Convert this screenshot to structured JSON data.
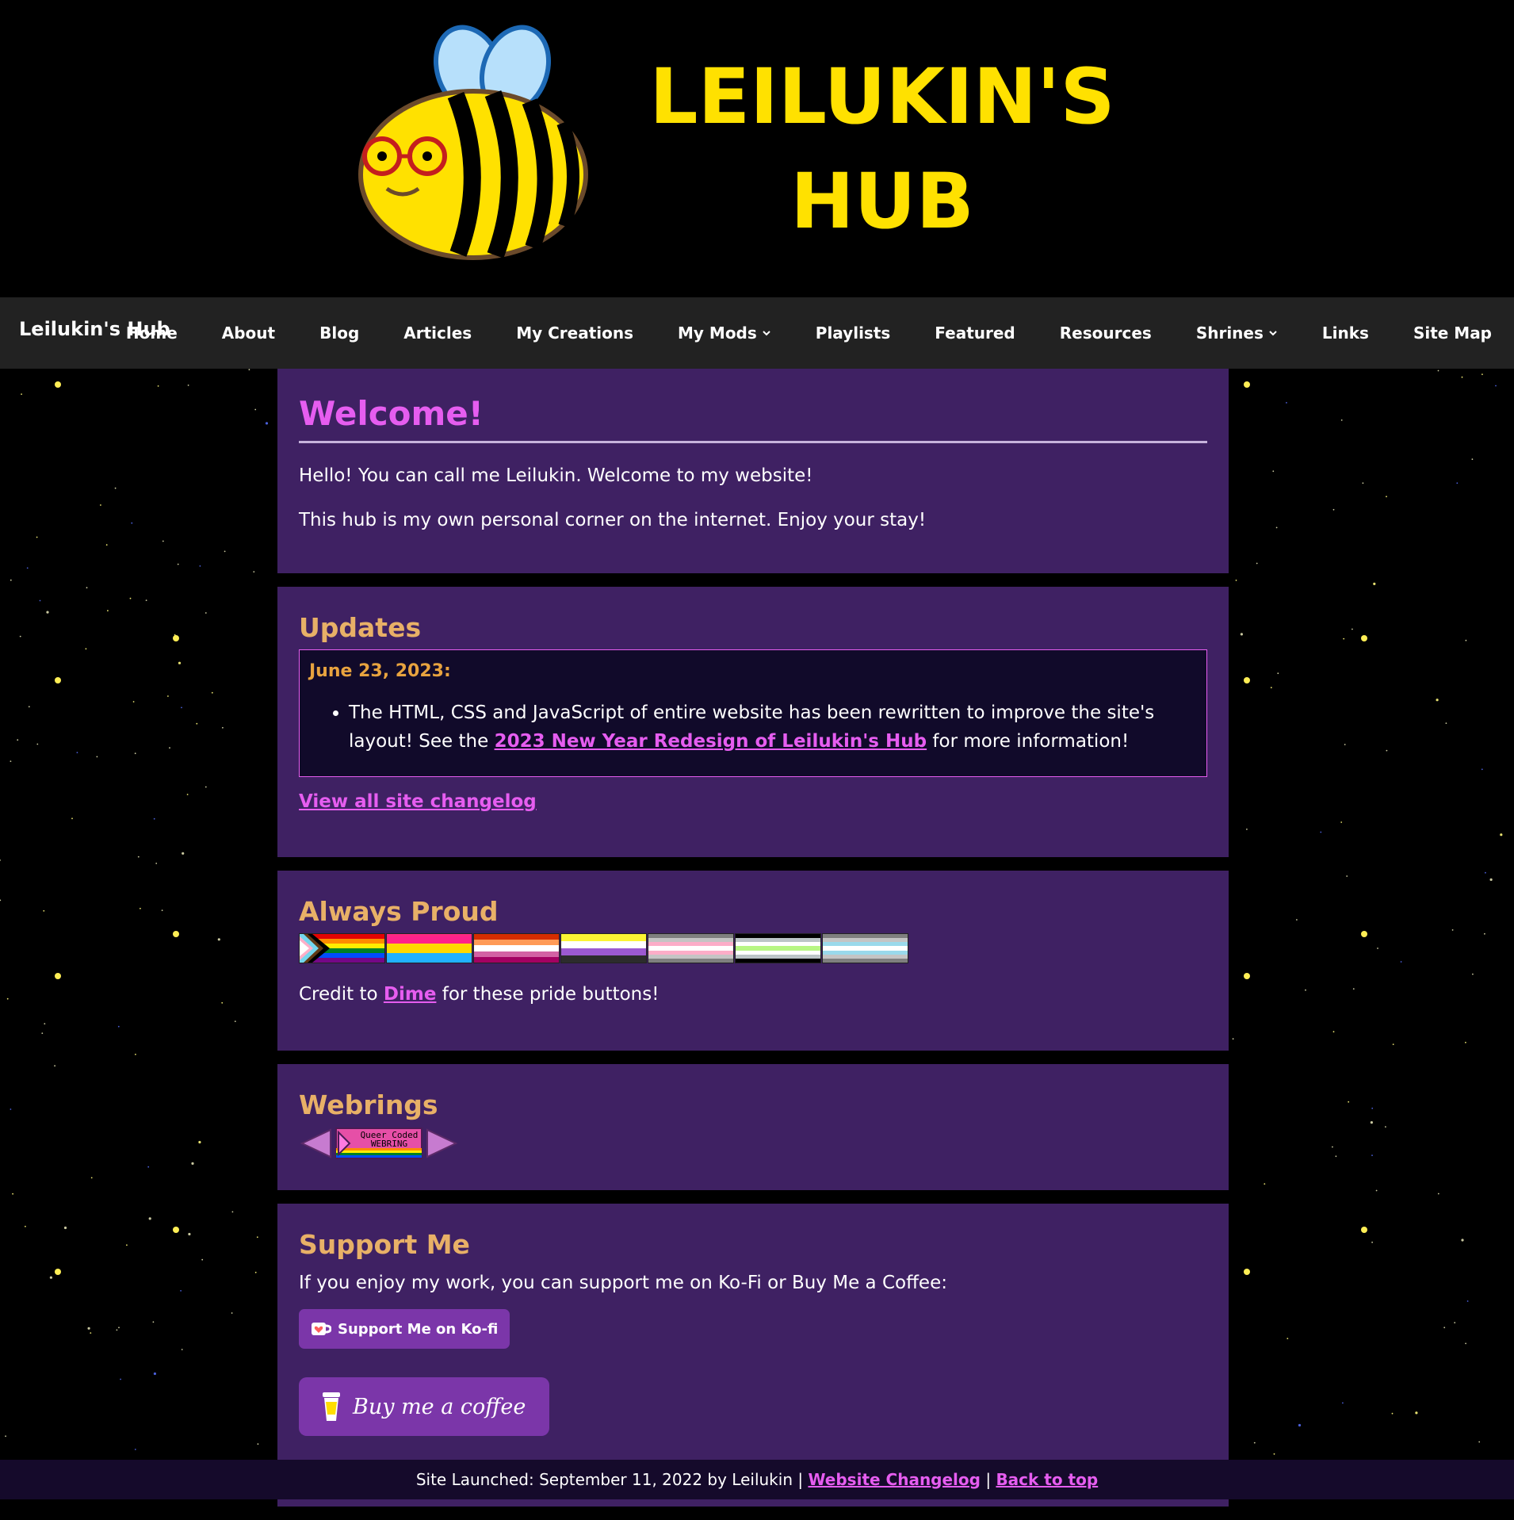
{
  "banner": {
    "logo_line1": "LEILUKIN'S",
    "logo_line2": "HUB",
    "mascot": "bee-with-glasses-icon"
  },
  "navbar": {
    "brand": "Leilukin's Hub",
    "items": [
      {
        "label": "Home"
      },
      {
        "label": "About"
      },
      {
        "label": "Blog"
      },
      {
        "label": "Articles"
      },
      {
        "label": "My Creations"
      },
      {
        "label": "My Mods",
        "dropdown": true
      },
      {
        "label": "Playlists"
      },
      {
        "label": "Featured"
      },
      {
        "label": "Resources"
      },
      {
        "label": "Shrines",
        "dropdown": true
      },
      {
        "label": "Links"
      },
      {
        "label": "Site Map"
      }
    ]
  },
  "welcome": {
    "title": "Welcome!",
    "p1": "Hello! You can call me Leilukin. Welcome to my website!",
    "p2": "This hub is my own personal corner on the internet. Enjoy your stay!"
  },
  "updates": {
    "title": "Updates",
    "date": "June 23, 2023:",
    "item_text_before": "The HTML, CSS and JavaScript of entire website has been rewritten to improve the site's layout! See the ",
    "item_link": "2023 New Year Redesign of Leilukin's Hub",
    "item_text_after": " for more information!",
    "changelog_link": "View all site changelog"
  },
  "proud": {
    "title": "Always Proud",
    "buttons": [
      "progress-pride-flag",
      "pansexual-flag",
      "lesbian-flag",
      "nonbinary-flag",
      "demigirl-flag",
      "agender-flag",
      "demiboy-flag"
    ],
    "credit_before": "Credit to ",
    "credit_link": "Dime",
    "credit_after": " for these pride buttons!"
  },
  "webrings": {
    "title": "Webrings",
    "badge_line1": "Queer Coded",
    "badge_line2": "WEBRING"
  },
  "support": {
    "title": "Support Me",
    "text": "If you enjoy my work, you can support me on Ko-Fi or Buy Me a Coffee:",
    "kofi_label": "Support Me on Ko-fi",
    "bmc_label": "Buy me a coffee"
  },
  "footer": {
    "text": "Site Launched: September 11, 2022 by Leilukin | ",
    "changelog_link": "Website Changelog",
    "separator": " | ",
    "top_link": "Back to top"
  },
  "colors": {
    "accent": "#e65df0",
    "heading": "#e8b067",
    "card_bg": "#3f2163",
    "logo_yellow": "#ffe100"
  }
}
